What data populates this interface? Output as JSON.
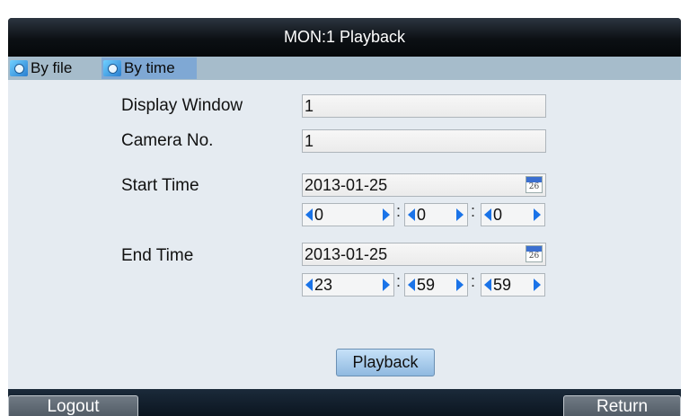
{
  "window": {
    "title": "MON:1 Playback"
  },
  "tabs": [
    {
      "label": "By file",
      "icon": "search-icon",
      "active": false
    },
    {
      "label": "By time",
      "icon": "search-icon",
      "active": true
    }
  ],
  "form": {
    "display_window": {
      "label": "Display Window",
      "value": "1"
    },
    "camera_no": {
      "label": "Camera No.",
      "value": "1"
    },
    "start_time": {
      "label": "Start Time",
      "date": "2013-01-25",
      "calendar_day": "26",
      "hour": "0",
      "minute": "0",
      "second": "0"
    },
    "end_time": {
      "label": "End Time",
      "date": "2013-01-25",
      "calendar_day": "26",
      "hour": "23",
      "minute": "59",
      "second": "59"
    },
    "separator": ":"
  },
  "actions": {
    "playback_label": "Playback"
  },
  "footer": {
    "logout_label": "Logout",
    "return_label": "Return"
  },
  "colors": {
    "accent": "#1a73e8",
    "tab_active": "#7fa8d4",
    "panel_bg": "#e5ebf1"
  }
}
